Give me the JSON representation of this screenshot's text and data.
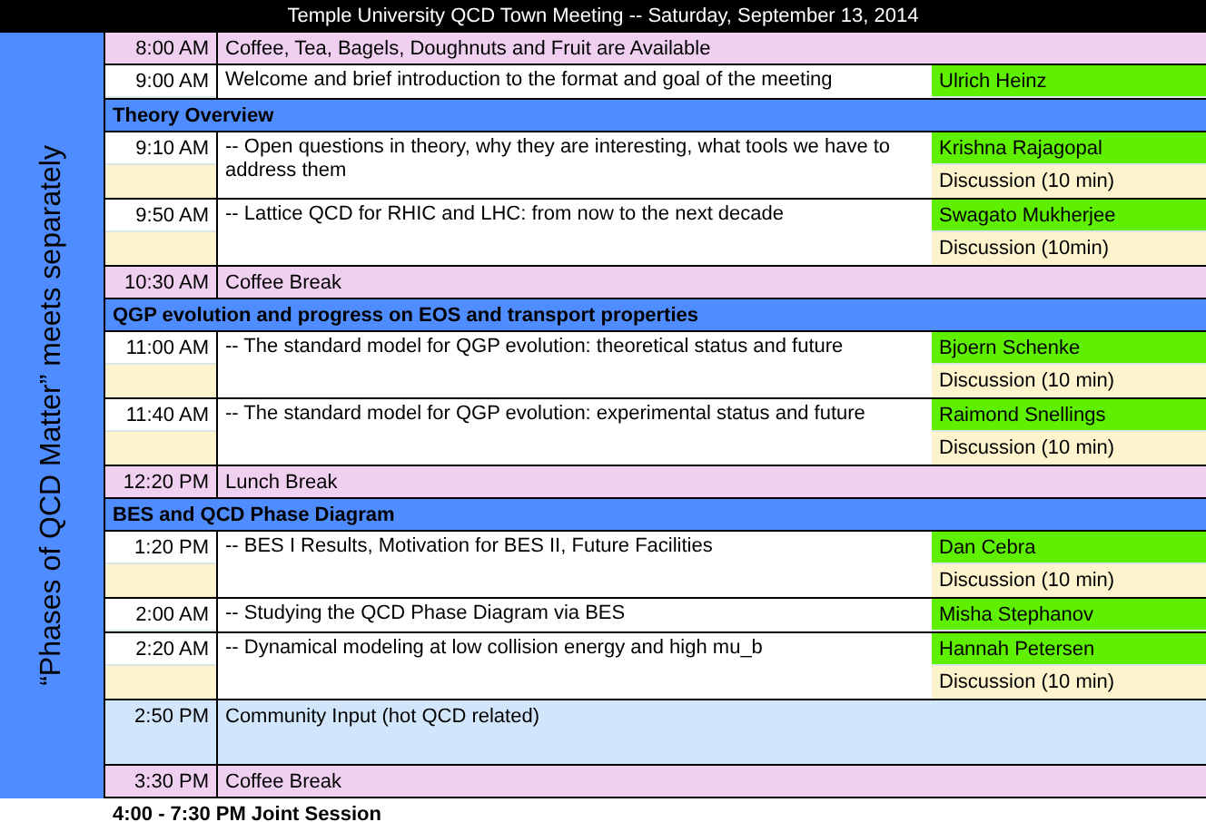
{
  "title": "Temple University QCD Town Meeting -- Saturday, September 13, 2014",
  "side_label": "“Phases of QCD Matter” meets separately",
  "rows": [
    {
      "kind": "break",
      "time": "8:00 AM",
      "title": "Coffee, Tea, Bagels, Doughnuts and Fruit are Available"
    },
    {
      "kind": "talk",
      "time": "9:00 AM",
      "title": "Welcome and brief introduction to the format and goal of the meeting",
      "speaker": "Ulrich Heinz"
    },
    {
      "kind": "section",
      "title": "Theory Overview"
    },
    {
      "kind": "talk",
      "time": "9:10 AM",
      "title": "-- Open questions in theory, why they are interesting, what tools we have to address them",
      "speaker": "Krishna Rajagopal",
      "discussion": "Discussion (10 min)"
    },
    {
      "kind": "talk",
      "time": "9:50 AM",
      "title": "-- Lattice QCD for RHIC and LHC: from now to the next decade",
      "speaker": "Swagato Mukherjee",
      "discussion": "Discussion (10min)"
    },
    {
      "kind": "break",
      "time": "10:30 AM",
      "title": "Coffee Break"
    },
    {
      "kind": "section",
      "title": "QGP evolution and progress on EOS and transport properties"
    },
    {
      "kind": "talk",
      "time": "11:00 AM",
      "title": "-- The standard model for QGP evolution: theoretical status and future",
      "speaker": "Bjoern Schenke",
      "discussion": "Discussion (10 min)"
    },
    {
      "kind": "talk",
      "time": "11:40 AM",
      "title": "-- The standard model for QGP evolution: experimental status and future",
      "speaker": "Raimond Snellings",
      "discussion": "Discussion (10 min)"
    },
    {
      "kind": "break",
      "time": "12:20 PM",
      "title": "Lunch Break"
    },
    {
      "kind": "section",
      "title": "BES and QCD Phase Diagram"
    },
    {
      "kind": "talk",
      "time": "1:20 PM",
      "title": "-- BES I Results, Motivation for BES II, Future Facilities",
      "speaker": "Dan Cebra",
      "discussion": "Discussion (10 min)"
    },
    {
      "kind": "talk",
      "time": "2:00 AM",
      "title": "-- Studying the QCD Phase Diagram via BES",
      "speaker": "Misha Stephanov"
    },
    {
      "kind": "talk",
      "time": "2:20 AM",
      "title": "-- Dynamical modeling at low collision energy and high mu_b",
      "speaker": "Hannah Petersen",
      "discussion": "Discussion (10 min)"
    },
    {
      "kind": "community",
      "time": "2:50 PM",
      "title": "Community Input (hot QCD related)"
    },
    {
      "kind": "break",
      "time": "3:30 PM",
      "title": "Coffee Break"
    }
  ],
  "joint": "4:00 - 7:30 PM Joint Session"
}
